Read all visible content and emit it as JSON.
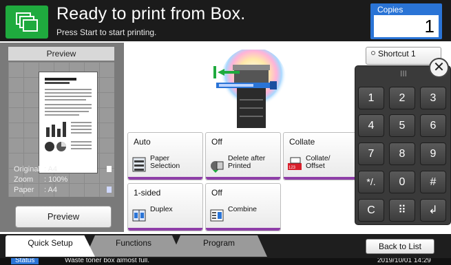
{
  "header": {
    "title": "Ready to print from Box.",
    "subtitle": "Press Start to start printing.",
    "copies_label": "Copies",
    "copies_value": "1"
  },
  "preview_panel": {
    "heading": "Preview",
    "original_label": "Original",
    "original_value": ": A4",
    "zoom_label": "Zoom",
    "zoom_value": ": 100%",
    "paper_label": "Paper",
    "paper_value": ": A4",
    "preview_button": "Preview"
  },
  "settings": [
    {
      "value": "Auto",
      "label": "Paper\nSelection",
      "icon": "paper-selection-icon"
    },
    {
      "value": "Off",
      "label": "Delete after\nPrinted",
      "icon": "delete-after-printed-icon"
    },
    {
      "value": "Collate",
      "label": "Collate/\nOffset",
      "icon": "collate-offset-icon"
    },
    {
      "value": "1-sided",
      "label": "Duplex",
      "icon": "duplex-icon"
    },
    {
      "value": "Off",
      "label": "Combine",
      "icon": "combine-icon"
    }
  ],
  "shortcut": {
    "label": "Shortcut 1"
  },
  "keypad": {
    "handle": "III",
    "keys": [
      "1",
      "2",
      "3",
      "4",
      "5",
      "6",
      "7",
      "8",
      "9",
      "*/.",
      "0",
      "#",
      "C",
      "⠿",
      "↲"
    ]
  },
  "tabs": {
    "quick_setup": "Quick Setup",
    "functions": "Functions",
    "program": "Program"
  },
  "back_button": "Back to List",
  "status": {
    "label": "Status",
    "message": "Waste toner box almost full.",
    "datetime": "2019/10/01 14:29"
  }
}
